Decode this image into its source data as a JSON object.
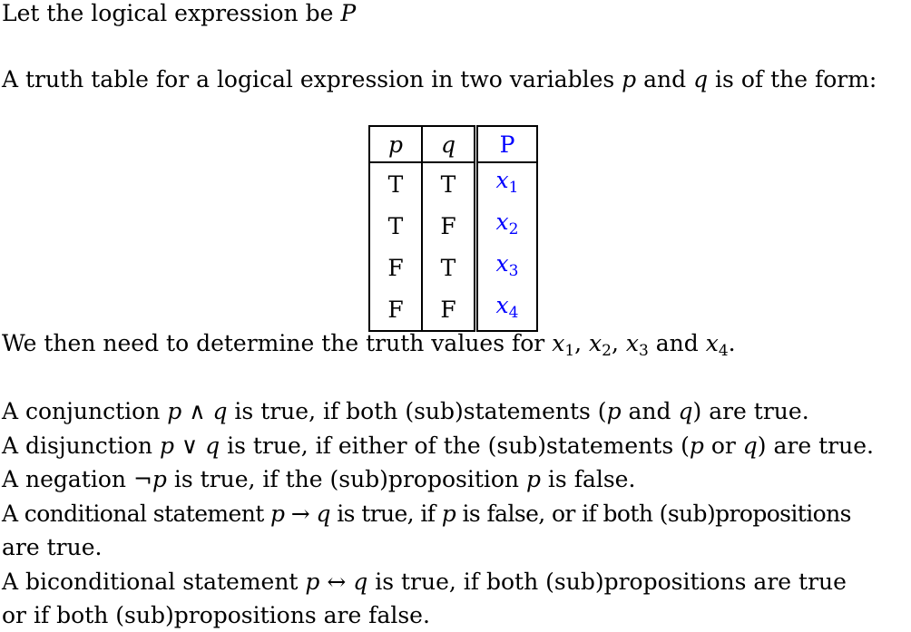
{
  "intro": {
    "line1_text": "Let the logical expression be ",
    "line1_var": "P",
    "line2_text": "A truth table for a logical expression in two variables ",
    "line2_p": "p",
    "line2_and": " and ",
    "line2_q": "q",
    "line2_end": " is of the form:"
  },
  "table": {
    "headers": [
      "p",
      "q",
      "P"
    ],
    "rows": [
      [
        "T",
        "T",
        "x",
        "1"
      ],
      [
        "T",
        "F",
        "x",
        "2"
      ],
      [
        "F",
        "T",
        "x",
        "3"
      ],
      [
        "F",
        "F",
        "x",
        "4"
      ]
    ],
    "accent_color": "#0000ff"
  },
  "determine": {
    "text": "We then need to determine the truth values for ",
    "x": "x",
    "s1": "1",
    "s2": "2",
    "s3": "3",
    "s4": "4",
    "comma": ", ",
    "and": " and ",
    "end": "."
  },
  "rules": {
    "conj": {
      "a": "A conjunction ",
      "expr": "p ∧ q",
      "b": " is true, if both (sub)statements (",
      "p": "p",
      "and": " and ",
      "q": "q",
      "c": ") are true."
    },
    "disj": {
      "a": "A disjunction ",
      "expr": "p ∨ q",
      "b": " is true, if either of the (sub)statements (",
      "p": "p",
      "or": " or ",
      "q": "q",
      "c": ") are true."
    },
    "neg": {
      "a": "A negation ",
      "expr": "¬p",
      "b": " is true, if the (sub)proposition ",
      "p": "p",
      "c": " is false."
    },
    "cond": {
      "a": "A conditional statement ",
      "expr": "p → q",
      "b": " is true, if ",
      "p": "p",
      "c": " is false, or if both (sub)propositions",
      "d": "are true."
    },
    "bicond": {
      "a": "A biconditional statement ",
      "expr": "p ↔ q",
      "b": " is true, if both (sub)propositions are true",
      "c": "or if both (sub)propositions are false."
    }
  }
}
